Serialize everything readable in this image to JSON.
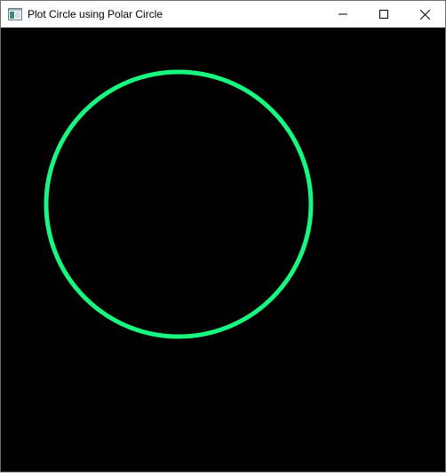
{
  "window": {
    "title": "Plot Circle using Polar Circle",
    "icons": {
      "app": "app-window-icon",
      "minimize": "minimize-icon",
      "maximize": "maximize-icon",
      "close": "close-icon"
    }
  },
  "canvas": {
    "background_color": "#000000",
    "shape": {
      "type": "circle",
      "stroke_color": "#18f880",
      "fill": "none"
    }
  }
}
